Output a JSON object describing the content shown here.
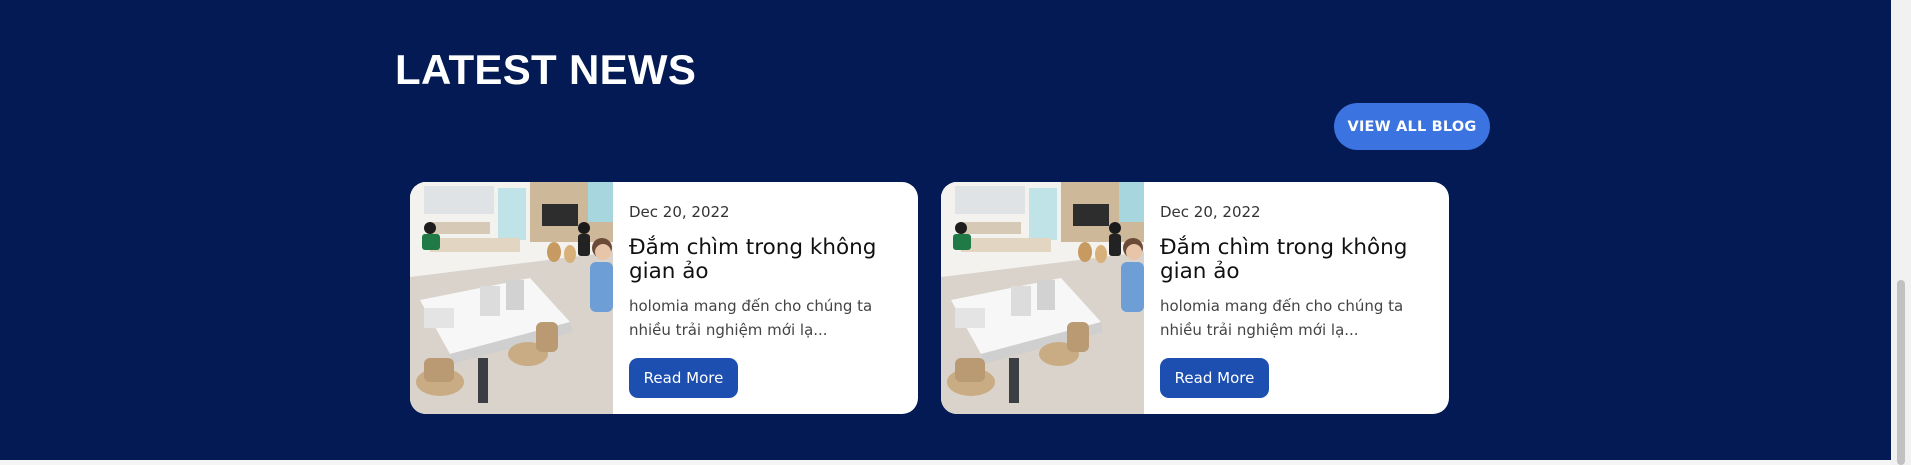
{
  "section": {
    "title": "LATEST NEWS",
    "view_all_label": "VIEW ALL BLOG"
  },
  "colors": {
    "background": "#031a54",
    "view_all_button": "#3b73e0",
    "read_more_button": "#1d4fb0",
    "card": "#ffffff"
  },
  "cards": [
    {
      "date": "Dec 20, 2022",
      "title": "Đắm chìm trong không gian ảo",
      "excerpt": "holomia mang đến cho chúng ta nhiều trải nghiệm mới lạ...",
      "read_more_label": "Read More"
    },
    {
      "date": "Dec 20, 2022",
      "title": "Đắm chìm trong không gian ảo",
      "excerpt": "holomia mang đến cho chúng ta nhiều trải nghiệm mới lạ...",
      "read_more_label": "Read More"
    }
  ]
}
